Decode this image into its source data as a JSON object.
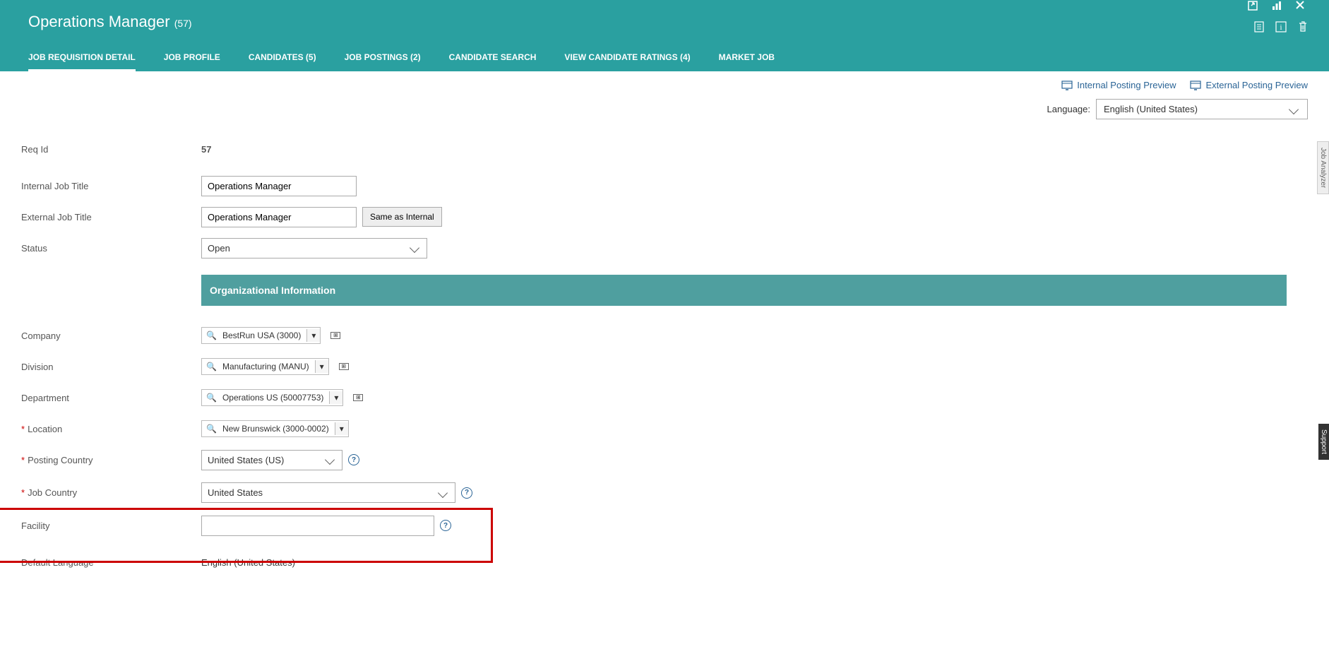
{
  "header": {
    "title": "Operations Manager",
    "count": "(57)"
  },
  "tabs": [
    {
      "label": "JOB REQUISITION DETAIL",
      "active": true
    },
    {
      "label": "JOB PROFILE"
    },
    {
      "label": "CANDIDATES (5)"
    },
    {
      "label": "JOB POSTINGS (2)"
    },
    {
      "label": "CANDIDATE SEARCH"
    },
    {
      "label": "VIEW CANDIDATE RATINGS (4)"
    },
    {
      "label": "MARKET JOB"
    }
  ],
  "preview": {
    "internal": "Internal Posting Preview",
    "external": "External Posting Preview"
  },
  "language": {
    "label": "Language:",
    "value": "English (United States)"
  },
  "section": {
    "org": "Organizational Information"
  },
  "form": {
    "reqid_label": "Req Id",
    "reqid_value": "57",
    "internal_title_label": "Internal Job Title",
    "internal_title_value": "Operations Manager",
    "external_title_label": "External Job Title",
    "external_title_value": "Operations Manager",
    "same_as_internal": "Same as Internal",
    "status_label": "Status",
    "status_value": "Open",
    "company_label": "Company",
    "company_value": "BestRun USA (3000)",
    "division_label": "Division",
    "division_value": "Manufacturing (MANU)",
    "department_label": "Department",
    "department_value": "Operations US (50007753)",
    "location_label": "Location",
    "location_value": "New Brunswick (3000-0002)",
    "posting_country_label": "Posting Country",
    "posting_country_value": "United States (US)",
    "job_country_label": "Job Country",
    "job_country_value": "United States",
    "facility_label": "Facility",
    "facility_value": "",
    "default_lang_label": "Default Language",
    "default_lang_value": "English (United States)"
  },
  "side": {
    "analyzer": "Job Analyzer",
    "support": "Support"
  }
}
